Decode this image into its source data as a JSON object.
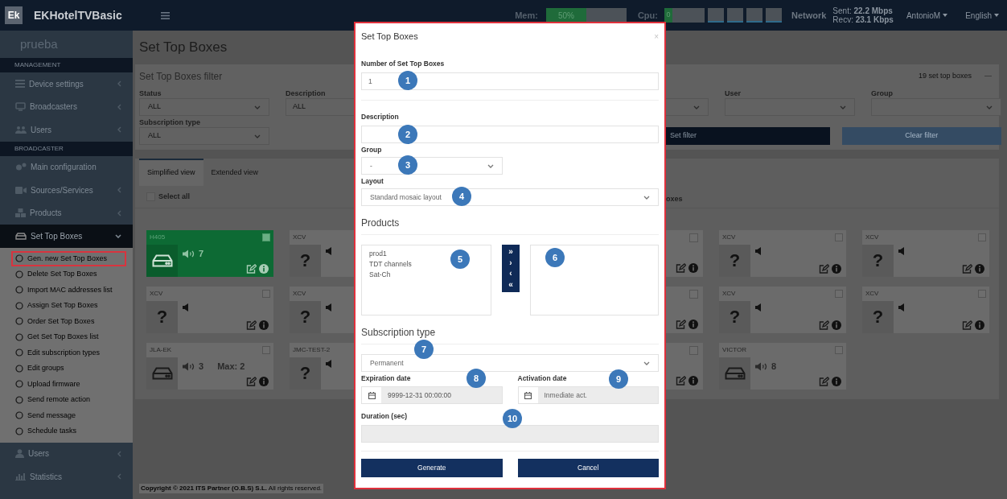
{
  "topbar": {
    "logo": "Ek",
    "app_name": "EKHotelTVBasic",
    "mem": {
      "label": "Mem:",
      "text": "50%",
      "level": 0.5
    },
    "cpu": {
      "label": "Cpu:",
      "text": "0",
      "level": 0.2
    },
    "network": {
      "label": "Network",
      "sent": "Sent: **22.2 Mbps**",
      "recv": "Recv: **23.1 Kbps**"
    },
    "user": "AntonioM",
    "language": "English"
  },
  "sidebar": {
    "title": "prueba",
    "sections": [
      {
        "header": "MANAGEMENT",
        "items": [
          {
            "label": "Device settings",
            "arrow": true,
            "expanded": false
          },
          {
            "label": "Broadcasters",
            "arrow": true,
            "expanded": false
          },
          {
            "label": "Users",
            "arrow": true,
            "expanded": false
          }
        ]
      },
      {
        "header": "BROADCASTER",
        "items": [
          {
            "label": "Main configuration",
            "arrow": false,
            "expanded": false
          },
          {
            "label": "Sources/Services",
            "arrow": true,
            "expanded": false
          },
          {
            "label": "Products",
            "arrow": true,
            "expanded": false
          },
          {
            "label": "Set Top Boxes",
            "arrow": true,
            "expanded": true,
            "children": [
              {
                "label": "Gen. new Set Top Boxes",
                "selected": true
              },
              {
                "label": "Delete Set Top Boxes",
                "selected": false
              },
              {
                "label": "Import MAC addresses list",
                "selected": false
              },
              {
                "label": "Assign Set Top Boxes",
                "selected": false
              },
              {
                "label": "Order Set Top Boxes",
                "selected": false
              },
              {
                "label": "Get Set Top Boxes list",
                "selected": false
              },
              {
                "label": "Edit subscription types",
                "selected": false
              },
              {
                "label": "Edit groups",
                "selected": false
              },
              {
                "label": "Upload firmware",
                "selected": false
              },
              {
                "label": "Send remote action",
                "selected": false
              },
              {
                "label": "Send message",
                "selected": false
              },
              {
                "label": "Schedule tasks",
                "selected": false
              }
            ]
          },
          {
            "label": "Users",
            "arrow": true,
            "expanded": false
          },
          {
            "label": "Statistics",
            "arrow": true,
            "expanded": false
          }
        ]
      }
    ]
  },
  "page_title": "Set Top Boxes",
  "filter": {
    "title": "Set Top Boxes filter",
    "count": "19 set top boxes",
    "collapse": "—",
    "fields": [
      {
        "kind": "select",
        "label": "Status",
        "value": "ALL"
      },
      {
        "kind": "text",
        "label": "Description",
        "value": "ALL"
      },
      {
        "kind": "covered"
      },
      {
        "kind": "select"
      },
      {
        "kind": "select",
        "label": "User"
      },
      {
        "kind": "select",
        "label": "Group"
      },
      {
        "kind": "select",
        "label": "Subscription type",
        "value": "ALL"
      }
    ],
    "buttons": [
      {
        "label": "Set filter",
        "kind": "primary"
      },
      {
        "label": "Clear filter",
        "kind": "secondary"
      }
    ]
  },
  "tabs": [
    {
      "label": "Simplified view",
      "selected": true
    },
    {
      "label": "Extended view",
      "selected": false
    }
  ],
  "select_all": {
    "label": "Select all",
    "checked": false
  },
  "list_heading": "oxes",
  "cards": [
    {
      "kind": "box",
      "name": "H405",
      "volume": "7",
      "active": true,
      "checked": false
    },
    {
      "kind": "partial-left",
      "name": "XCV",
      "mark": "?"
    },
    {
      "kind": "covered"
    },
    {
      "kind": "partial-right",
      "checked": false
    },
    {
      "kind": "box",
      "name": "XCV",
      "mark": "?",
      "active": false,
      "checked": false
    },
    {
      "kind": "box",
      "name": "XCV",
      "mark": "?",
      "active": false,
      "checked": false
    },
    {
      "kind": "box",
      "name": "XCV",
      "mark": "?",
      "active": false,
      "checked": false
    },
    {
      "kind": "partial-left",
      "name": "XCV",
      "mark": "?"
    },
    {
      "kind": "covered"
    },
    {
      "kind": "partial-right",
      "checked": false
    },
    {
      "kind": "box",
      "name": "XCV",
      "mark": "?",
      "active": false,
      "checked": false
    },
    {
      "kind": "box",
      "name": "XCV",
      "mark": "?",
      "active": false,
      "checked": false
    },
    {
      "kind": "box",
      "name": "JLA-EK",
      "volume": "3",
      "max": "Max: 2",
      "active": false,
      "checked": false
    },
    {
      "kind": "partial-left",
      "name": "JMC-TEST-2",
      "mark": "?"
    },
    {
      "kind": "covered"
    },
    {
      "kind": "partial-right",
      "checked": false
    },
    {
      "kind": "box",
      "name": "VICTOR",
      "volume": "8",
      "active": false,
      "checked": false
    }
  ],
  "footer": "**Copyright © 2021 ITS Partner (O.B.S) S.L.** All rights reserved.",
  "modal": {
    "title": "Set Top Boxes",
    "close": "×",
    "number": {
      "label": "Number of Set Top Boxes",
      "value": "1"
    },
    "description": {
      "label": "Description"
    },
    "group": {
      "label": "Group",
      "value": "-"
    },
    "layout": {
      "label": "Layout",
      "value": "Standard mosaic layout"
    },
    "products": {
      "heading": "Products",
      "available": [
        "prod1",
        "TDT channels",
        "Sat-Ch"
      ],
      "arrows": [
        "»",
        "›",
        "‹",
        "«"
      ]
    },
    "subscription": {
      "heading": "Subscription type",
      "value": "Permanent"
    },
    "expiration": {
      "label": "Expiration date",
      "value": "9999-12-31 00:00:00"
    },
    "activation": {
      "label": "Activation date",
      "placeholder": "Inmediate act."
    },
    "duration": {
      "label": "Duration (sec)"
    },
    "buttons": [
      "Generate",
      "Cancel"
    ]
  },
  "markers": [
    "1",
    "2",
    "3",
    "4",
    "5",
    "6",
    "7",
    "8",
    "9",
    "10"
  ]
}
